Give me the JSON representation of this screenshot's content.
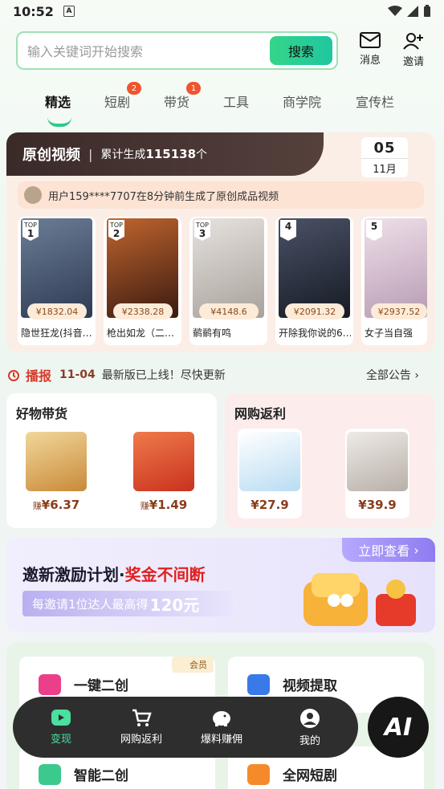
{
  "status": {
    "time": "10:52",
    "a_icon": "A"
  },
  "search": {
    "placeholder": "输入关键词开始搜索",
    "button": "搜索"
  },
  "header_icons": {
    "messages": "消息",
    "invite": "邀请"
  },
  "tabs": [
    {
      "label": "精选",
      "badge": ""
    },
    {
      "label": "短剧",
      "badge": "2"
    },
    {
      "label": "带货",
      "badge": "1"
    },
    {
      "label": "工具",
      "badge": ""
    },
    {
      "label": "商学院",
      "badge": ""
    },
    {
      "label": "宣传栏",
      "badge": ""
    }
  ],
  "original_video": {
    "title": "原创视频",
    "count_prefix": "累计生成",
    "count": "115138",
    "count_suffix": "个",
    "date_day": "05",
    "date_month": "11月",
    "notice": "用户159****7707在8分钟前生成了原创成品视频",
    "items": [
      {
        "rank": "1",
        "top": "TOP",
        "price": "¥1832.04",
        "name": "隐世狂龙(抖音…",
        "color": "#3d4f6a"
      },
      {
        "rank": "2",
        "top": "TOP",
        "price": "¥2338.28",
        "name": "枪出如龙（二…",
        "color": "#7a3a22"
      },
      {
        "rank": "3",
        "top": "TOP",
        "price": "¥4148.6",
        "name": "鹡鹡有鸣",
        "color": "#c9c3c0"
      },
      {
        "rank": "4",
        "top": "",
        "price": "¥2091.32",
        "name": "开除我你说的6…",
        "color": "#2a2f3c"
      },
      {
        "rank": "5",
        "top": "",
        "price": "¥2937.52",
        "name": "女子当自强",
        "color": "#d8bfcf"
      }
    ]
  },
  "broadcast": {
    "label": "播报",
    "date": "11-04",
    "message": "最新版已上线！尽快更新",
    "all": "全部公告"
  },
  "good_products": {
    "title": "好物带货",
    "items": [
      {
        "prefix": "赚",
        "price": "¥6.37",
        "color": "#e2b46a"
      },
      {
        "prefix": "赚",
        "price": "¥1.49",
        "color": "#e05a3a"
      }
    ]
  },
  "rebate": {
    "title": "网购返利",
    "items": [
      {
        "price": "¥27.9",
        "color": "#cfe6f5"
      },
      {
        "price": "¥39.9",
        "color": "#d8d2cc"
      }
    ]
  },
  "banner": {
    "title_a": "邀新激励计划·",
    "title_b": "奖金不间断",
    "sub_a": "每邀请1位达人最高得",
    "sub_b": "120元",
    "go": "立即查看"
  },
  "tools": {
    "member": "会员",
    "items": [
      "一键二创",
      "视频提取",
      "智能二创",
      "全网短剧"
    ]
  },
  "bottom_nav": [
    "变现",
    "网购返利",
    "爆料赚佣",
    "我的"
  ],
  "ai_button": "AI",
  "colors": {
    "accent": "#2cc98a",
    "badge": "#f0542d",
    "nav_bg": "#2e2e2e"
  }
}
